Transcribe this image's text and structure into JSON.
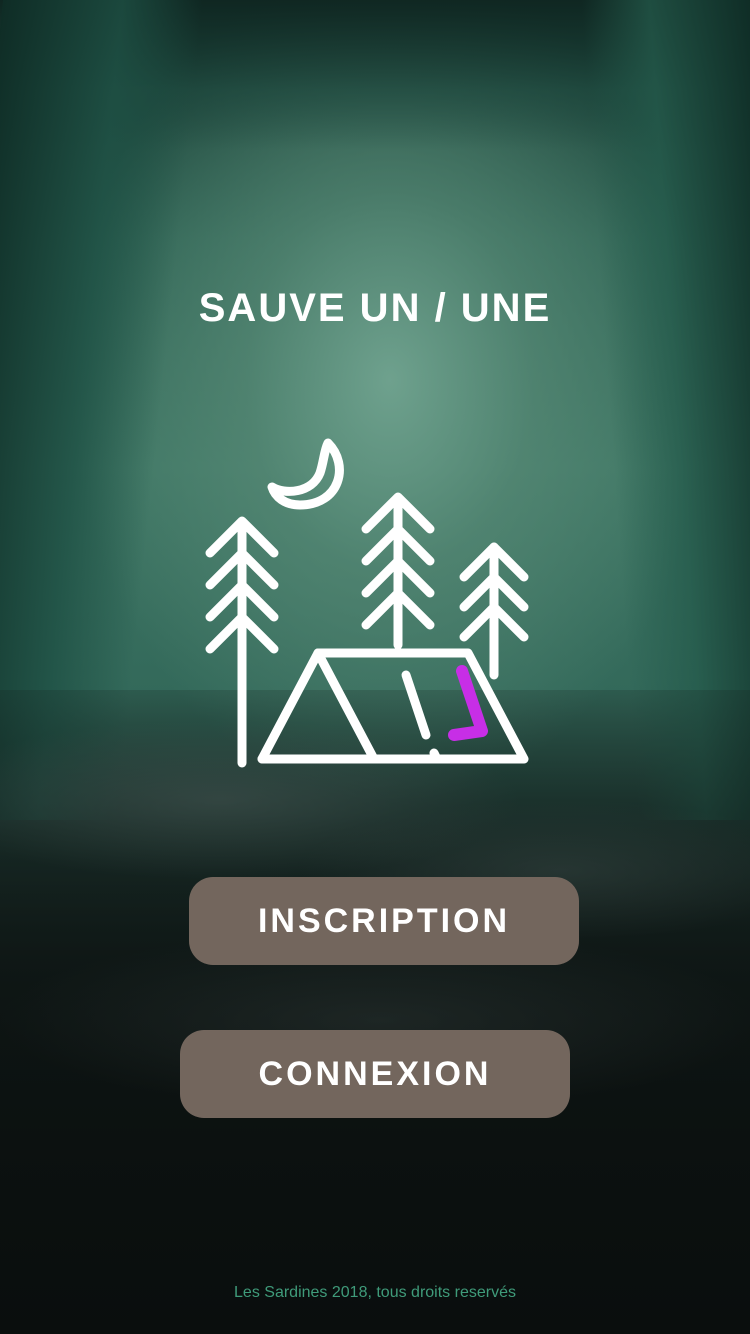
{
  "app": {
    "title": "SAUVE UN / UNE"
  },
  "logo": {
    "icon": "camping-tent-trees-moon-icon",
    "accent_color": "#c72ee6",
    "line_color": "#ffffff"
  },
  "buttons": {
    "inscription_label": "INSCRIPTION",
    "connexion_label": "CONNEXION",
    "background_color": "#73665d"
  },
  "footer": {
    "text": "Les Sardines 2018, tous droits reservés",
    "color": "#3f9b7a"
  }
}
